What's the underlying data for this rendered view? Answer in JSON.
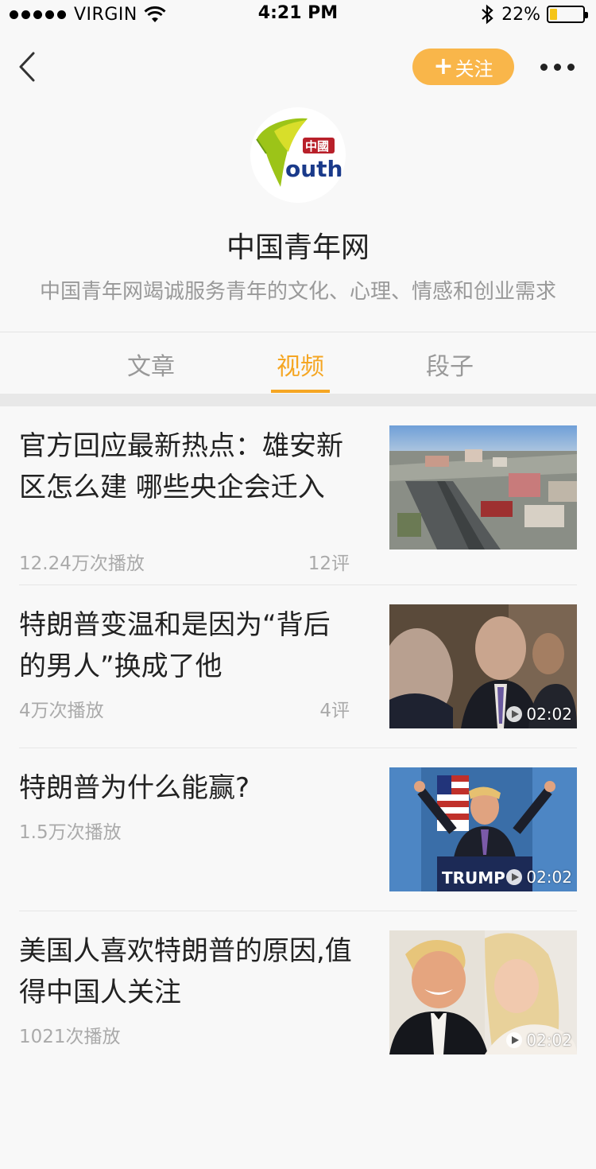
{
  "status_bar": {
    "carrier": "VIRGIN",
    "time": "4:21 PM",
    "battery": "22%",
    "battery_level": 0.22
  },
  "nav": {
    "follow_label": "关注",
    "back_icon": "chevron-left-icon",
    "more_icon": "more-icon"
  },
  "profile": {
    "logo_text": "outh",
    "logo_stamp": "中國",
    "name": "中国青年网",
    "description": "中国青年网竭诚服务青年的文化、心理、情感和创业需求"
  },
  "tabs": [
    {
      "label": "文章",
      "active": false
    },
    {
      "label": "视频",
      "active": true
    },
    {
      "label": "段子",
      "active": false
    }
  ],
  "feed": [
    {
      "title": "官方回应最新热点：雄安新区怎么建 哪些央企会迁入",
      "plays": "12.24万次播放",
      "comments": "12评",
      "duration": ""
    },
    {
      "title": "特朗普变温和是因为“背后的男人”换成了他",
      "plays": "4万次播放",
      "comments": "4评",
      "duration": "02:02"
    },
    {
      "title": "特朗普为什么能赢?",
      "plays": "1.5万次播放",
      "comments": "",
      "duration": "02:02"
    },
    {
      "title": "美国人喜欢特朗普的原因,值得中国人关注",
      "plays": "1021次播放",
      "comments": "",
      "duration": "02:02"
    }
  ],
  "colors": {
    "accent": "#f5a623",
    "follow_button": "#f9b64a"
  }
}
